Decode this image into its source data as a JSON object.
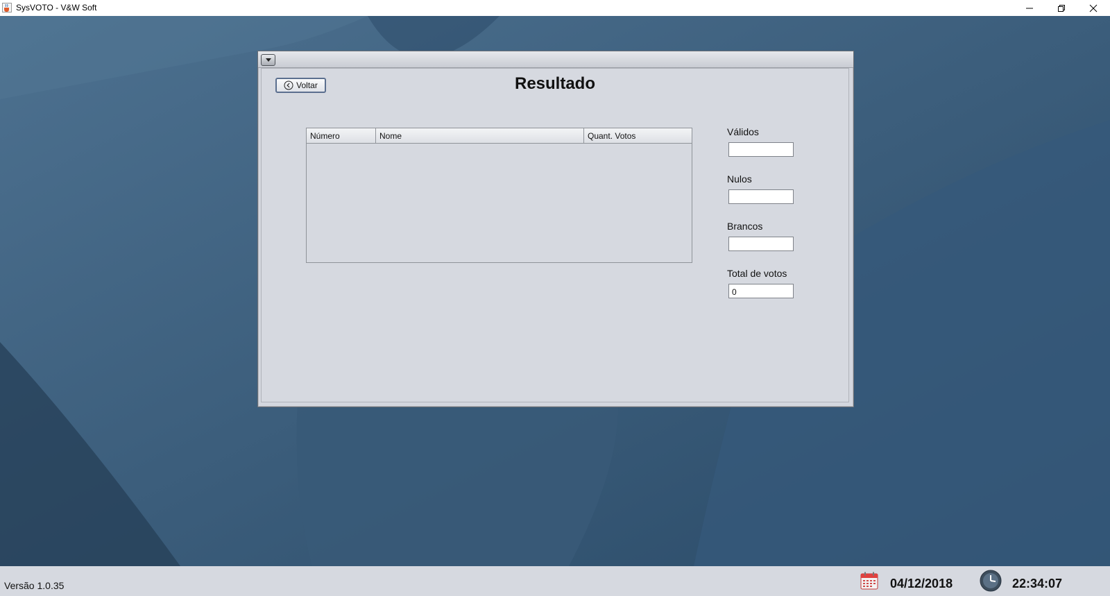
{
  "window": {
    "title": "SysVOTO - V&W Soft",
    "icon": "java-cup-icon",
    "controls": [
      "minimize-icon",
      "restore-icon",
      "close-icon"
    ]
  },
  "frame": {
    "title": "Resultado",
    "back_label": "Voltar",
    "back_icon": "chevron-left-circle-icon"
  },
  "table": {
    "headers": [
      "Número",
      "Nome",
      "Quant. Votos"
    ],
    "rows": []
  },
  "summary": {
    "validos_label": "Válidos",
    "validos_value": "",
    "nulos_label": "Nulos",
    "nulos_value": "",
    "brancos_label": "Brancos",
    "brancos_value": "",
    "total_label": "Total de votos",
    "total_value": "0"
  },
  "status": {
    "version": "Versão 1.0.35",
    "date": "04/12/2018",
    "time": "22:34:07"
  },
  "colors": {
    "desktop": "#2f5270",
    "panel": "#d6d9e0",
    "button_border": "#5b6f8f"
  }
}
